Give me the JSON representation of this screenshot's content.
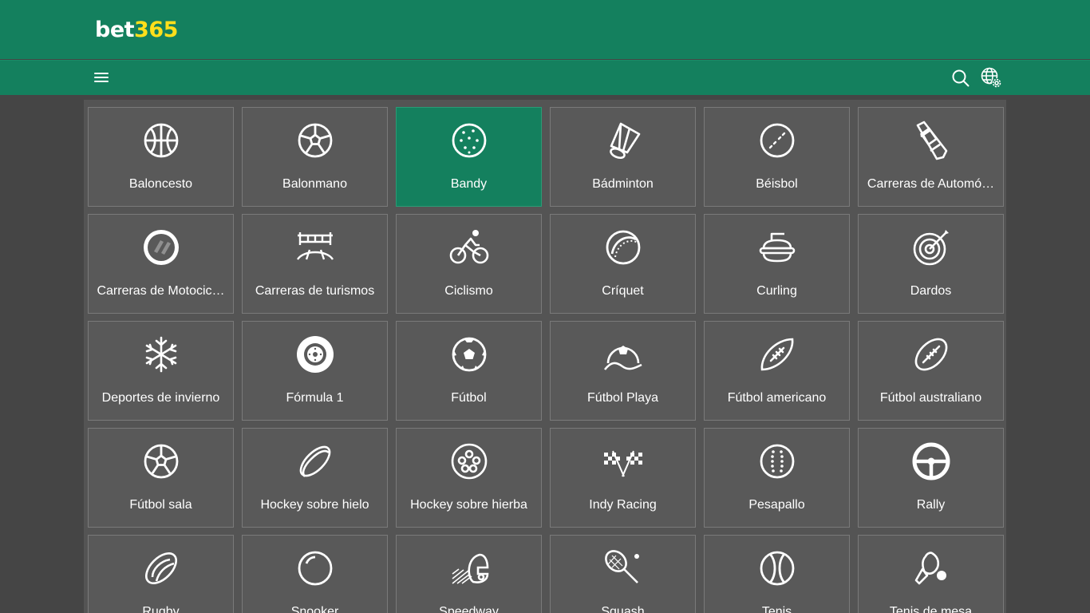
{
  "brand": {
    "part1": "bet",
    "part2": "365"
  },
  "header": {
    "menu_icon": "hamburger-icon",
    "search_icon": "search-icon",
    "language_icon": "globe-settings-icon"
  },
  "colors": {
    "brand_green": "#14805e",
    "logo_yellow": "#ffdf1b",
    "tile_bg": "#595959",
    "page_bg": "#454545"
  },
  "sports": [
    {
      "label": "Baloncesto",
      "icon": "basketball-icon"
    },
    {
      "label": "Balonmano",
      "icon": "handball-icon"
    },
    {
      "label": "Bandy",
      "icon": "bandy-ball-icon",
      "selected": true
    },
    {
      "label": "Bádminton",
      "icon": "shuttlecock-icon"
    },
    {
      "label": "Béisbol",
      "icon": "baseball-icon"
    },
    {
      "label": "Carreras de Automó…",
      "icon": "race-car-icon"
    },
    {
      "label": "Carreras de Motocic…",
      "icon": "motorcycle-wheel-icon"
    },
    {
      "label": "Carreras de turismos",
      "icon": "touring-car-track-icon"
    },
    {
      "label": "Ciclismo",
      "icon": "cyclist-icon"
    },
    {
      "label": "Críquet",
      "icon": "cricket-ball-icon"
    },
    {
      "label": "Curling",
      "icon": "curling-stone-icon"
    },
    {
      "label": "Dardos",
      "icon": "dartboard-icon"
    },
    {
      "label": "Deportes de invierno",
      "icon": "snowflake-icon"
    },
    {
      "label": "Fórmula 1",
      "icon": "tyre-icon"
    },
    {
      "label": "Fútbol",
      "icon": "soccer-ball-icon"
    },
    {
      "label": "Fútbol Playa",
      "icon": "beach-soccer-icon"
    },
    {
      "label": "Fútbol americano",
      "icon": "american-football-icon"
    },
    {
      "label": "Fútbol australiano",
      "icon": "aussie-rules-ball-icon"
    },
    {
      "label": "Fútbol sala",
      "icon": "futsal-ball-icon"
    },
    {
      "label": "Hockey sobre hielo",
      "icon": "ice-hockey-puck-icon"
    },
    {
      "label": "Hockey sobre hierba",
      "icon": "field-hockey-ball-icon"
    },
    {
      "label": "Indy Racing",
      "icon": "checkered-flags-icon"
    },
    {
      "label": "Pesapallo",
      "icon": "pesapallo-ball-icon"
    },
    {
      "label": "Rally",
      "icon": "steering-wheel-icon"
    },
    {
      "label": "Rugby",
      "icon": "rugby-ball-icon"
    },
    {
      "label": "Snooker",
      "icon": "snooker-ball-icon"
    },
    {
      "label": "Speedway",
      "icon": "speedway-helmet-icon"
    },
    {
      "label": "Squash",
      "icon": "squash-racket-icon"
    },
    {
      "label": "Tenis",
      "icon": "tennis-ball-icon"
    },
    {
      "label": "Tenis de mesa",
      "icon": "table-tennis-icon"
    }
  ]
}
